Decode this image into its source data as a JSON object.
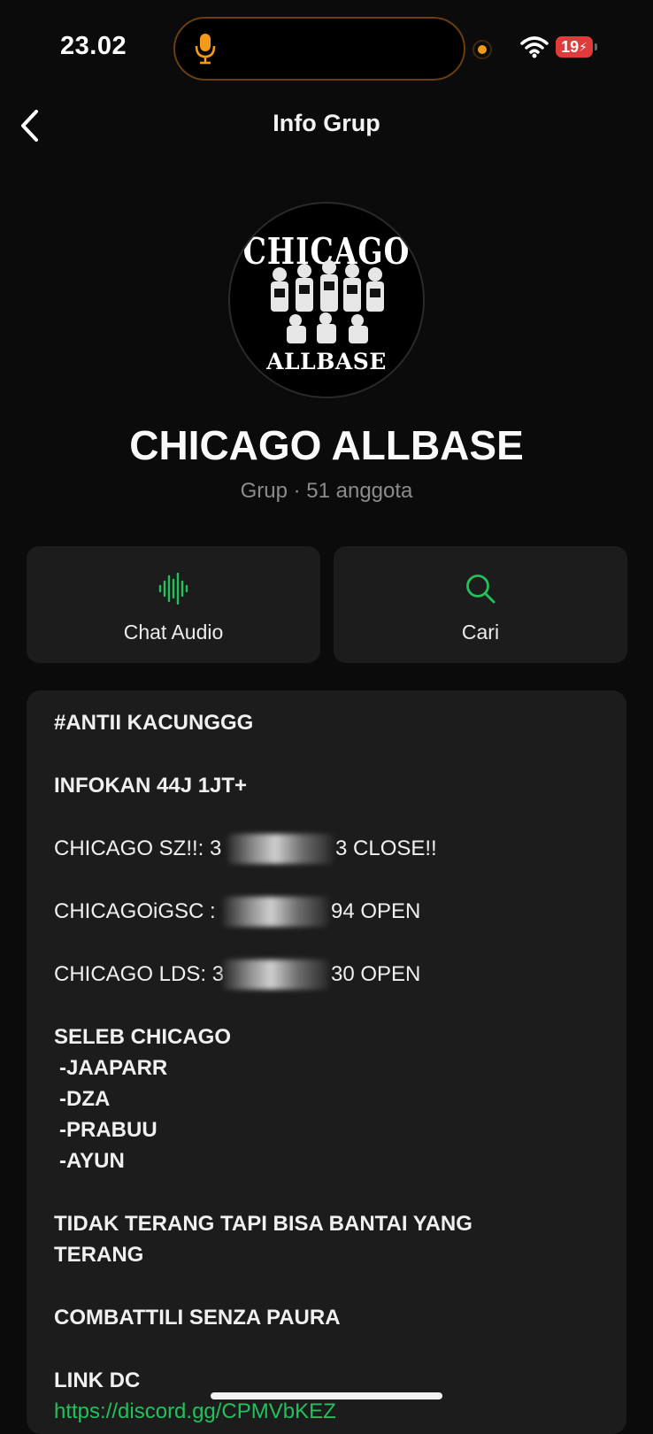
{
  "status_bar": {
    "time": "23.02",
    "battery": "19"
  },
  "nav": {
    "title": "Info Grup"
  },
  "group": {
    "avatar_top_text": "CHICAGO",
    "avatar_bottom_text": "ALLBASE",
    "name": "CHICAGO ALLBASE",
    "meta": "Grup · 51 anggota"
  },
  "actions": {
    "audio_label": "Chat Audio",
    "search_label": "Cari"
  },
  "description": {
    "line1": "#ANTII KACUNGGG",
    "line2": "INFOKAN 44J 1JT+",
    "sz_prefix": "CHICAGO SZ!!: 3",
    "sz_suffix": "3 CLOSE!!",
    "igsc_prefix": "CHICAGOiGSC : ",
    "igsc_suffix": "94 OPEN",
    "lds_prefix": "CHICAGO LDS: 3",
    "lds_suffix": "30 OPEN",
    "seleb_title": "SELEB CHICAGO",
    "seleb": [
      "-JAAPARR",
      "-DZA",
      "-PRABUU",
      "-AYUN"
    ],
    "tagline1": "TIDAK TERANG TAPI BISA BANTAI YANG",
    "tagline2": "TERANG",
    "motto": "COMBATTILI SENZA PAURA",
    "link_title": "LINK DC",
    "link_url": "https://discord.gg/CPMVbKEZ"
  },
  "colors": {
    "accent_green": "#23c05b",
    "mic_orange": "#f39a1a",
    "battery_red": "#e03b3b"
  }
}
